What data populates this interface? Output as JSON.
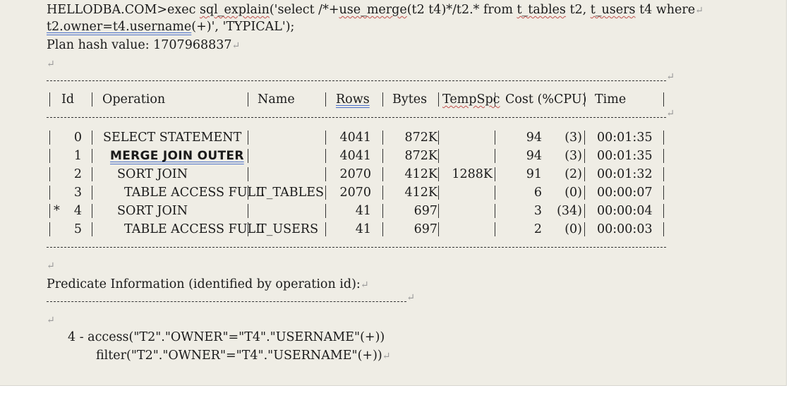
{
  "sql": {
    "line1_prefix": "HELLODBA.COM>exec ",
    "line1_call": "sql_explain",
    "line1_mid": "('select /*+",
    "line1_hint": "use_merge",
    "line1_rest1": "(t2 t4)*/t2.* from ",
    "line1_tab1": "t_tables",
    "line1_rest2": " t2, ",
    "line1_tab2": "t_users",
    "line1_rest3": " t4 where",
    "line2_cond": "t2.owner=t4.username",
    "line2_rest": "(+)', 'TYPICAL');",
    "plan_hash": "Plan hash value: 1707968837"
  },
  "plan_table": {
    "headers": [
      "Id",
      "Operation",
      "Name",
      "Rows",
      "Bytes",
      "TempSpc",
      "Cost (%CPU)",
      "Time"
    ],
    "rows": [
      {
        "mark": "",
        "id": "0",
        "operation": "SELECT STATEMENT",
        "name": "",
        "rows": "4041",
        "bytes": "872K",
        "tempspc": "",
        "cost": "94",
        "cpu": "(3)",
        "time": "00:01:35"
      },
      {
        "mark": "",
        "id": "1",
        "operation": "MERGE JOIN OUTER",
        "name": "",
        "rows": "4041",
        "bytes": "872K",
        "tempspc": "",
        "cost": "94",
        "cpu": "(3)",
        "time": "00:01:35"
      },
      {
        "mark": "",
        "id": "2",
        "operation": "SORT JOIN",
        "name": "",
        "rows": "2070",
        "bytes": "412K",
        "tempspc": "1288K",
        "cost": "91",
        "cpu": "(2)",
        "time": "00:01:32"
      },
      {
        "mark": "",
        "id": "3",
        "operation": "TABLE ACCESS FULL",
        "name": "T_TABLES",
        "rows": "2070",
        "bytes": "412K",
        "tempspc": "",
        "cost": "6",
        "cpu": "(0)",
        "time": "00:00:07"
      },
      {
        "mark": "*",
        "id": "4",
        "operation": "SORT JOIN",
        "name": "",
        "rows": "41",
        "bytes": "697",
        "tempspc": "",
        "cost": "3",
        "cpu": "(34)",
        "time": "00:00:04"
      },
      {
        "mark": "",
        "id": "5",
        "operation": "TABLE ACCESS FULL",
        "name": "T_USERS",
        "rows": "41",
        "bytes": "697",
        "tempspc": "",
        "cost": "2",
        "cpu": "(0)",
        "time": "00:00:03"
      }
    ]
  },
  "predicate": {
    "title": "Predicate Information (identified by operation id):",
    "line1": "4 - access(\"T2\".\"OWNER\"=\"T4\".\"USERNAME\"(+))",
    "line2": "filter(\"T2\".\"OWNER\"=\"T4\".\"USERNAME\"(+))"
  },
  "glyphs": {
    "return": "↵",
    "cell_mark": "‹"
  },
  "colors": {
    "paper": "#efede5",
    "spell": "#c0504d",
    "grammar": "#4a6fc9"
  }
}
